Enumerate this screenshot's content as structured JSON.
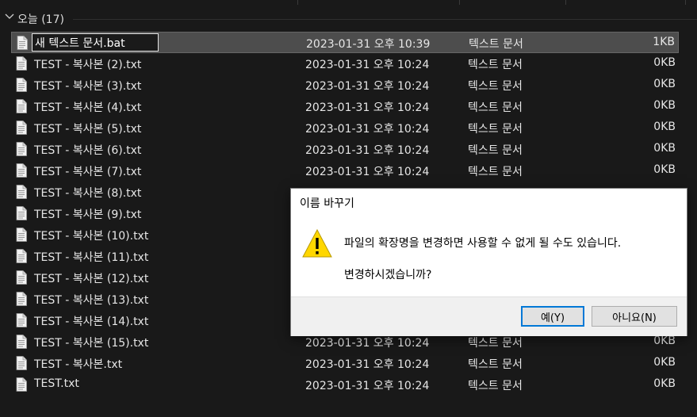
{
  "group": {
    "label": "오늘 (17)"
  },
  "rename_value": "새 텍스트 문서.bat",
  "files": [
    {
      "name": "새 텍스트 문서.bat",
      "date": "2023-01-31 오후 10:39",
      "type": "텍스트 문서",
      "size": "1KB"
    },
    {
      "name": "TEST - 복사본 (2).txt",
      "date": "2023-01-31 오후 10:24",
      "type": "텍스트 문서",
      "size": "0KB"
    },
    {
      "name": "TEST - 복사본 (3).txt",
      "date": "2023-01-31 오후 10:24",
      "type": "텍스트 문서",
      "size": "0KB"
    },
    {
      "name": "TEST - 복사본 (4).txt",
      "date": "2023-01-31 오후 10:24",
      "type": "텍스트 문서",
      "size": "0KB"
    },
    {
      "name": "TEST - 복사본 (5).txt",
      "date": "2023-01-31 오후 10:24",
      "type": "텍스트 문서",
      "size": "0KB"
    },
    {
      "name": "TEST - 복사본 (6).txt",
      "date": "2023-01-31 오후 10:24",
      "type": "텍스트 문서",
      "size": "0KB"
    },
    {
      "name": "TEST - 복사본 (7).txt",
      "date": "2023-01-31 오후 10:24",
      "type": "텍스트 문서",
      "size": "0KB"
    },
    {
      "name": "TEST - 복사본 (8).txt",
      "date": "",
      "type": "",
      "size": ""
    },
    {
      "name": "TEST - 복사본 (9).txt",
      "date": "",
      "type": "",
      "size": ""
    },
    {
      "name": "TEST - 복사본 (10).txt",
      "date": "",
      "type": "",
      "size": ""
    },
    {
      "name": "TEST - 복사본 (11).txt",
      "date": "",
      "type": "",
      "size": ""
    },
    {
      "name": "TEST - 복사본 (12).txt",
      "date": "",
      "type": "",
      "size": ""
    },
    {
      "name": "TEST - 복사본 (13).txt",
      "date": "",
      "type": "",
      "size": ""
    },
    {
      "name": "TEST - 복사본 (14).txt",
      "date": "",
      "type": "",
      "size": ""
    },
    {
      "name": "TEST - 복사본 (15).txt",
      "date": "2023-01-31 오후 10:24",
      "type": "텍스트 문서",
      "size": "0KB"
    },
    {
      "name": "TEST - 복사본.txt",
      "date": "2023-01-31 오후 10:24",
      "type": "텍스트 문서",
      "size": "0KB"
    },
    {
      "name": "TEST.txt",
      "date": "2023-01-31 오후 10:24",
      "type": "텍스트 문서",
      "size": "0KB"
    }
  ],
  "dialog": {
    "title": "이름 바꾸기",
    "message": "파일의 확장명을 변경하면 사용할 수 없게 될 수도 있습니다.",
    "question": "변경하시겠습니까?",
    "yes_label": "예(Y)",
    "no_label": "아니요(N)"
  },
  "colors": {
    "background": "#191919",
    "selected_row": "#4d4d4d",
    "primary_button_border": "#0078d7",
    "warning_yellow": "#ffd700"
  }
}
